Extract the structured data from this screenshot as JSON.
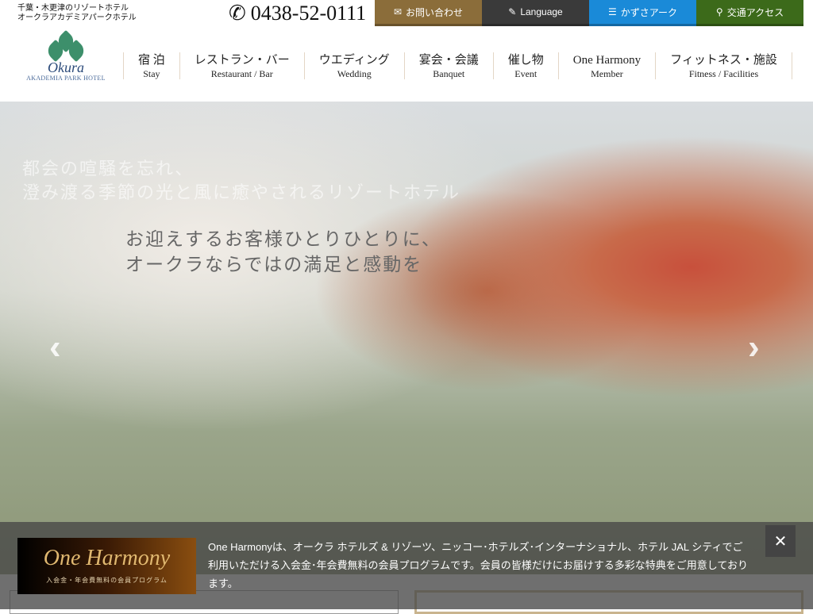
{
  "header": {
    "tagline_1": "千葉・木更津のリゾートホテル",
    "tagline_2": "オークラアカデミアパークホテル",
    "phone": "0438-52-0111",
    "top_buttons": [
      {
        "label": "お問い合わせ",
        "icon": "envelope-icon",
        "color": "#8b6d3a"
      },
      {
        "label": "Language",
        "icon": "pencil-icon",
        "color": "#3a3a3a"
      },
      {
        "label": "かずさアーク",
        "icon": "list-icon",
        "color": "#1a8ad8"
      },
      {
        "label": "交通アクセス",
        "icon": "map-pin-icon",
        "color": "#3c6a1a"
      }
    ],
    "logo": {
      "script": "Okura",
      "name": "AKADEMIA PARK HOTEL"
    }
  },
  "nav": [
    {
      "jp": "宿 泊",
      "en": "Stay"
    },
    {
      "jp": "レストラン・バー",
      "en": "Restaurant / Bar"
    },
    {
      "jp": "ウエディング",
      "en": "Wedding"
    },
    {
      "jp": "宴会・会議",
      "en": "Banquet"
    },
    {
      "jp": "催し物",
      "en": "Event"
    },
    {
      "jp": "One Harmony",
      "en": "Member"
    },
    {
      "jp": "フィットネス・施設",
      "en": "Fitness / Facilities"
    }
  ],
  "hero": {
    "copy_1a": "都会の喧騒を忘れ、",
    "copy_1b": "澄み渡る季節の光と風に癒やされるリゾートホテル",
    "copy_2a": "お迎えするお客様ひとりひとりに、",
    "copy_2b": "オークラならではの満足と感動を",
    "prev": "‹",
    "next": "›"
  },
  "banner": {
    "logo_title": "One Harmony",
    "logo_sub": "入会金・年会費無料の会員プログラム",
    "text": "One Harmonyは、オークラ ホテルズ & リゾーツ、ニッコー･ホテルズ･インターナショナル、ホテル JAL シティでご利用いただける入会金･年会費無料の会員プログラムです。会員の皆様だけにお届けする多彩な特典をご用意しております。",
    "close": "✕"
  }
}
